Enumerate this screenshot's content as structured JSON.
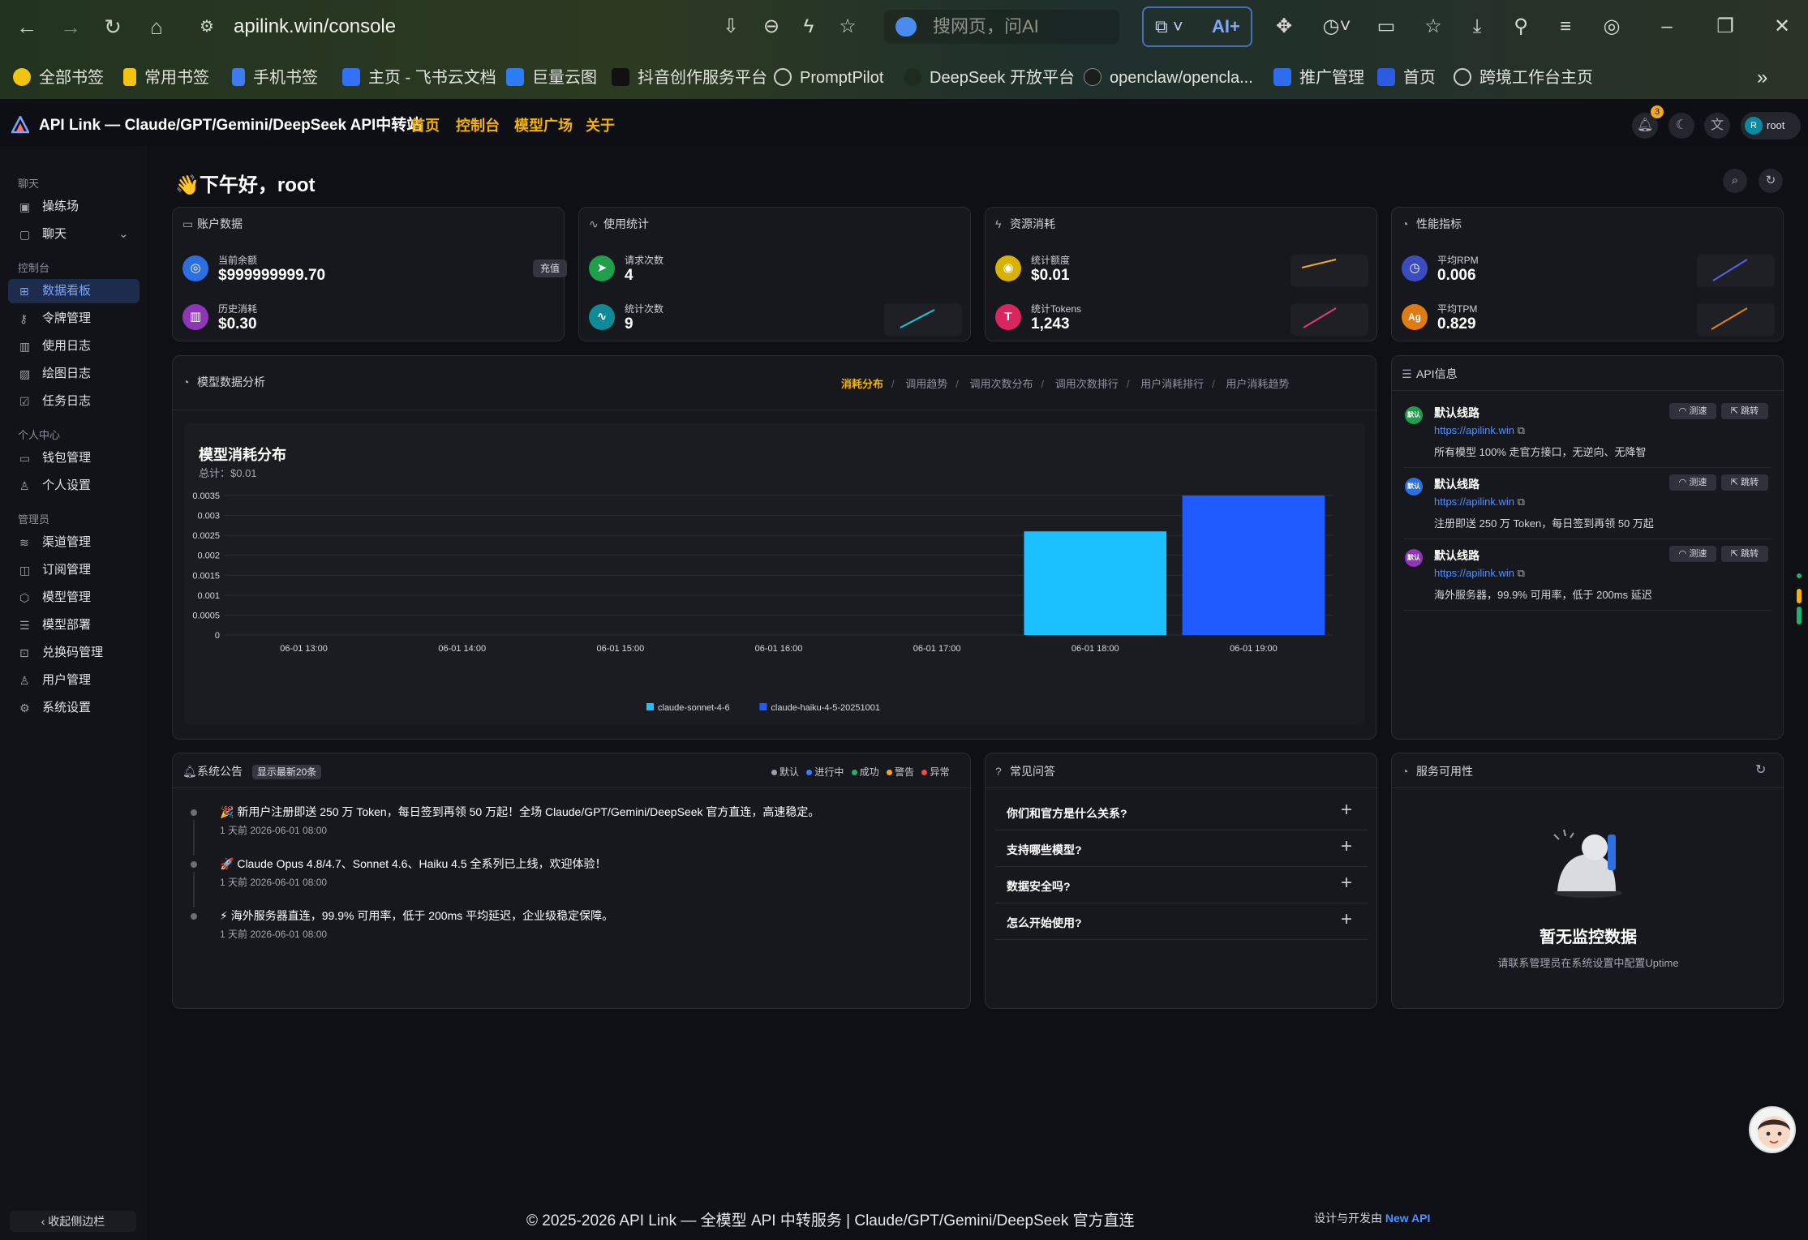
{
  "browser": {
    "url": "apilink.win/console",
    "search_placeholder": "搜网页，问AI",
    "ai_label": "AI+",
    "bookmarks": [
      "全部书签",
      "常用书签",
      "手机书签",
      "主页 - 飞书云文档",
      "巨量云图",
      "抖音创作服务平台",
      "PromptPilot",
      "DeepSeek 开放平台",
      "openclaw/opencla...",
      "推广管理",
      "首页",
      "跨境工作台主页"
    ]
  },
  "app": {
    "title": "API Link — Claude/GPT/Gemini/DeepSeek API中转站",
    "nav": [
      "首页",
      "控制台",
      "模型广场",
      "关于"
    ],
    "notif_count": "3",
    "user_initial": "R",
    "user_name": "root"
  },
  "sidebar": {
    "groups": [
      "聊天",
      "控制台",
      "个人中心",
      "管理员"
    ],
    "items": [
      "操练场",
      "聊天",
      "数据看板",
      "令牌管理",
      "使用日志",
      "绘图日志",
      "任务日志",
      "钱包管理",
      "个人设置",
      "渠道管理",
      "订阅管理",
      "模型管理",
      "模型部署",
      "兑换码管理",
      "用户管理",
      "系统设置"
    ],
    "collapse": "收起侧边栏"
  },
  "greeting": "👋下午好，root",
  "cards": {
    "account": {
      "title": "账户数据",
      "balance_label": "当前余额",
      "balance": "$999999999.70",
      "topup": "充值",
      "spent_label": "历史消耗",
      "spent": "$0.30"
    },
    "usage": {
      "title": "使用统计",
      "req_label": "请求次数",
      "req": "4",
      "stat_label": "统计次数",
      "stat": "9"
    },
    "resource": {
      "title": "资源消耗",
      "quota_label": "统计额度",
      "quota": "$0.01",
      "tokens_label": "统计Tokens",
      "tokens": "1,243"
    },
    "perf": {
      "title": "性能指标",
      "rpm_label": "平均RPM",
      "rpm": "0.006",
      "tpm_label": "平均TPM",
      "tpm": "0.829"
    }
  },
  "analysis": {
    "title": "模型数据分析",
    "tabs": [
      "消耗分布",
      "调用趋势",
      "调用次数分布",
      "调用次数排行",
      "用户消耗排行",
      "用户消耗趋势"
    ]
  },
  "chart_data": {
    "type": "bar",
    "title": "模型消耗分布",
    "subtitle": "总计：$0.01",
    "categories": [
      "06-01 13:00",
      "06-01 14:00",
      "06-01 15:00",
      "06-01 16:00",
      "06-01 17:00",
      "06-01 18:00",
      "06-01 19:00"
    ],
    "series": [
      {
        "name": "claude-sonnet-4-6",
        "color": "#1bc1ff",
        "values": [
          0,
          0,
          0,
          0,
          0,
          0.0026,
          0
        ]
      },
      {
        "name": "claude-haiku-4-5-20251001",
        "color": "#1f5bff",
        "values": [
          0,
          0,
          0,
          0,
          0,
          0,
          0.0035
        ]
      }
    ],
    "yticks": [
      "0",
      "0.0005",
      "0.001",
      "0.0015",
      "0.002",
      "0.0025",
      "0.003",
      "0.0035"
    ],
    "ylim": [
      0,
      0.0035
    ],
    "legend": "bottom"
  },
  "api_info": {
    "title": "API信息",
    "test": "测速",
    "jump": "跳转",
    "icon_text": "默认",
    "routes": [
      {
        "name": "默认线路",
        "url": "https://apilink.win",
        "desc": "所有模型 100% 走官方接口，无逆向、无降智"
      },
      {
        "name": "默认线路",
        "url": "https://apilink.win",
        "desc": "注册即送 250 万 Token，每日签到再领 50 万起"
      },
      {
        "name": "默认线路",
        "url": "https://apilink.win",
        "desc": "海外服务器，99.9% 可用率，低于 200ms 延迟"
      }
    ]
  },
  "announcements": {
    "title": "系统公告",
    "badge": "显示最新20条",
    "legend": [
      "默认",
      "进行中",
      "成功",
      "警告",
      "异常"
    ],
    "items": [
      {
        "icon": "🎉",
        "text": "新用户注册即送 250 万 Token，每日签到再领 50 万起！全场 Claude/GPT/Gemini/DeepSeek 官方直连，高速稳定。",
        "time": "1 天前 2026-06-01 08:00"
      },
      {
        "icon": "🚀",
        "text": "Claude Opus 4.8/4.7、Sonnet 4.6、Haiku 4.5 全系列已上线，欢迎体验！",
        "time": "1 天前 2026-06-01 08:00"
      },
      {
        "icon": "⚡",
        "text": "海外服务器直连，99.9% 可用率，低于 200ms 平均延迟，企业级稳定保障。",
        "time": "1 天前 2026-06-01 08:00"
      }
    ]
  },
  "faq": {
    "title": "常见问答",
    "items": [
      "你们和官方是什么关系?",
      "支持哪些模型?",
      "数据安全吗?",
      "怎么开始使用?"
    ]
  },
  "uptime": {
    "title": "服务可用性",
    "empty_title": "暂无监控数据",
    "empty_desc": "请联系管理员在系统设置中配置Uptime"
  },
  "footer": {
    "copyright": "© 2025-2026 API Link — 全模型 API 中转服务 | Claude/GPT/Gemini/DeepSeek 官方直连",
    "credit_prefix": "设计与开发由",
    "credit_link": "New API"
  }
}
